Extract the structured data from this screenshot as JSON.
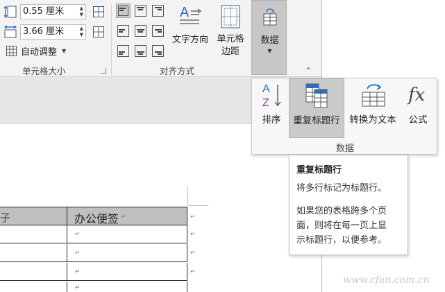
{
  "cell_size_group": {
    "height_value": "0.55 厘米",
    "width_value": "3.66 厘米",
    "autofit_label": "自动调整",
    "group_label": "单元格大小"
  },
  "alignment_group": {
    "text_direction_label": "文字方向",
    "cell_margins_line1": "单元格",
    "cell_margins_line2": "边距",
    "group_label": "对齐方式"
  },
  "data_button": {
    "label": "数据"
  },
  "data_flyout": {
    "buttons": [
      {
        "label": "排序",
        "icon": "sort-az-icon"
      },
      {
        "label": "重复标题行",
        "icon": "repeat-header-rows-icon"
      },
      {
        "label": "转换为文本",
        "icon": "convert-to-text-icon"
      },
      {
        "label": "公式",
        "icon": "formula-fx-icon"
      }
    ],
    "group_label": "数据"
  },
  "tooltip": {
    "title": "重复标题行",
    "line1": "将多行标记为标题行。",
    "para_lines": [
      "如果您的表格跨多个页",
      "面，则将在每一页上显",
      "示标题行，以便参考。"
    ]
  },
  "document": {
    "header_partial": "子",
    "header_cell": "办公便签",
    "paragraph_mark": "↵"
  },
  "watermark": "www.cfan.com.cn",
  "colors": {
    "ribbon_bg": "#f3f3f3",
    "selected_bg": "#c8c8c8",
    "header_fill": "#c0c0c0",
    "sort_a_blue": "#2e6dbf",
    "sort_z_purple": "#7b3fa6",
    "refresh_blue": "#2e79c9"
  }
}
